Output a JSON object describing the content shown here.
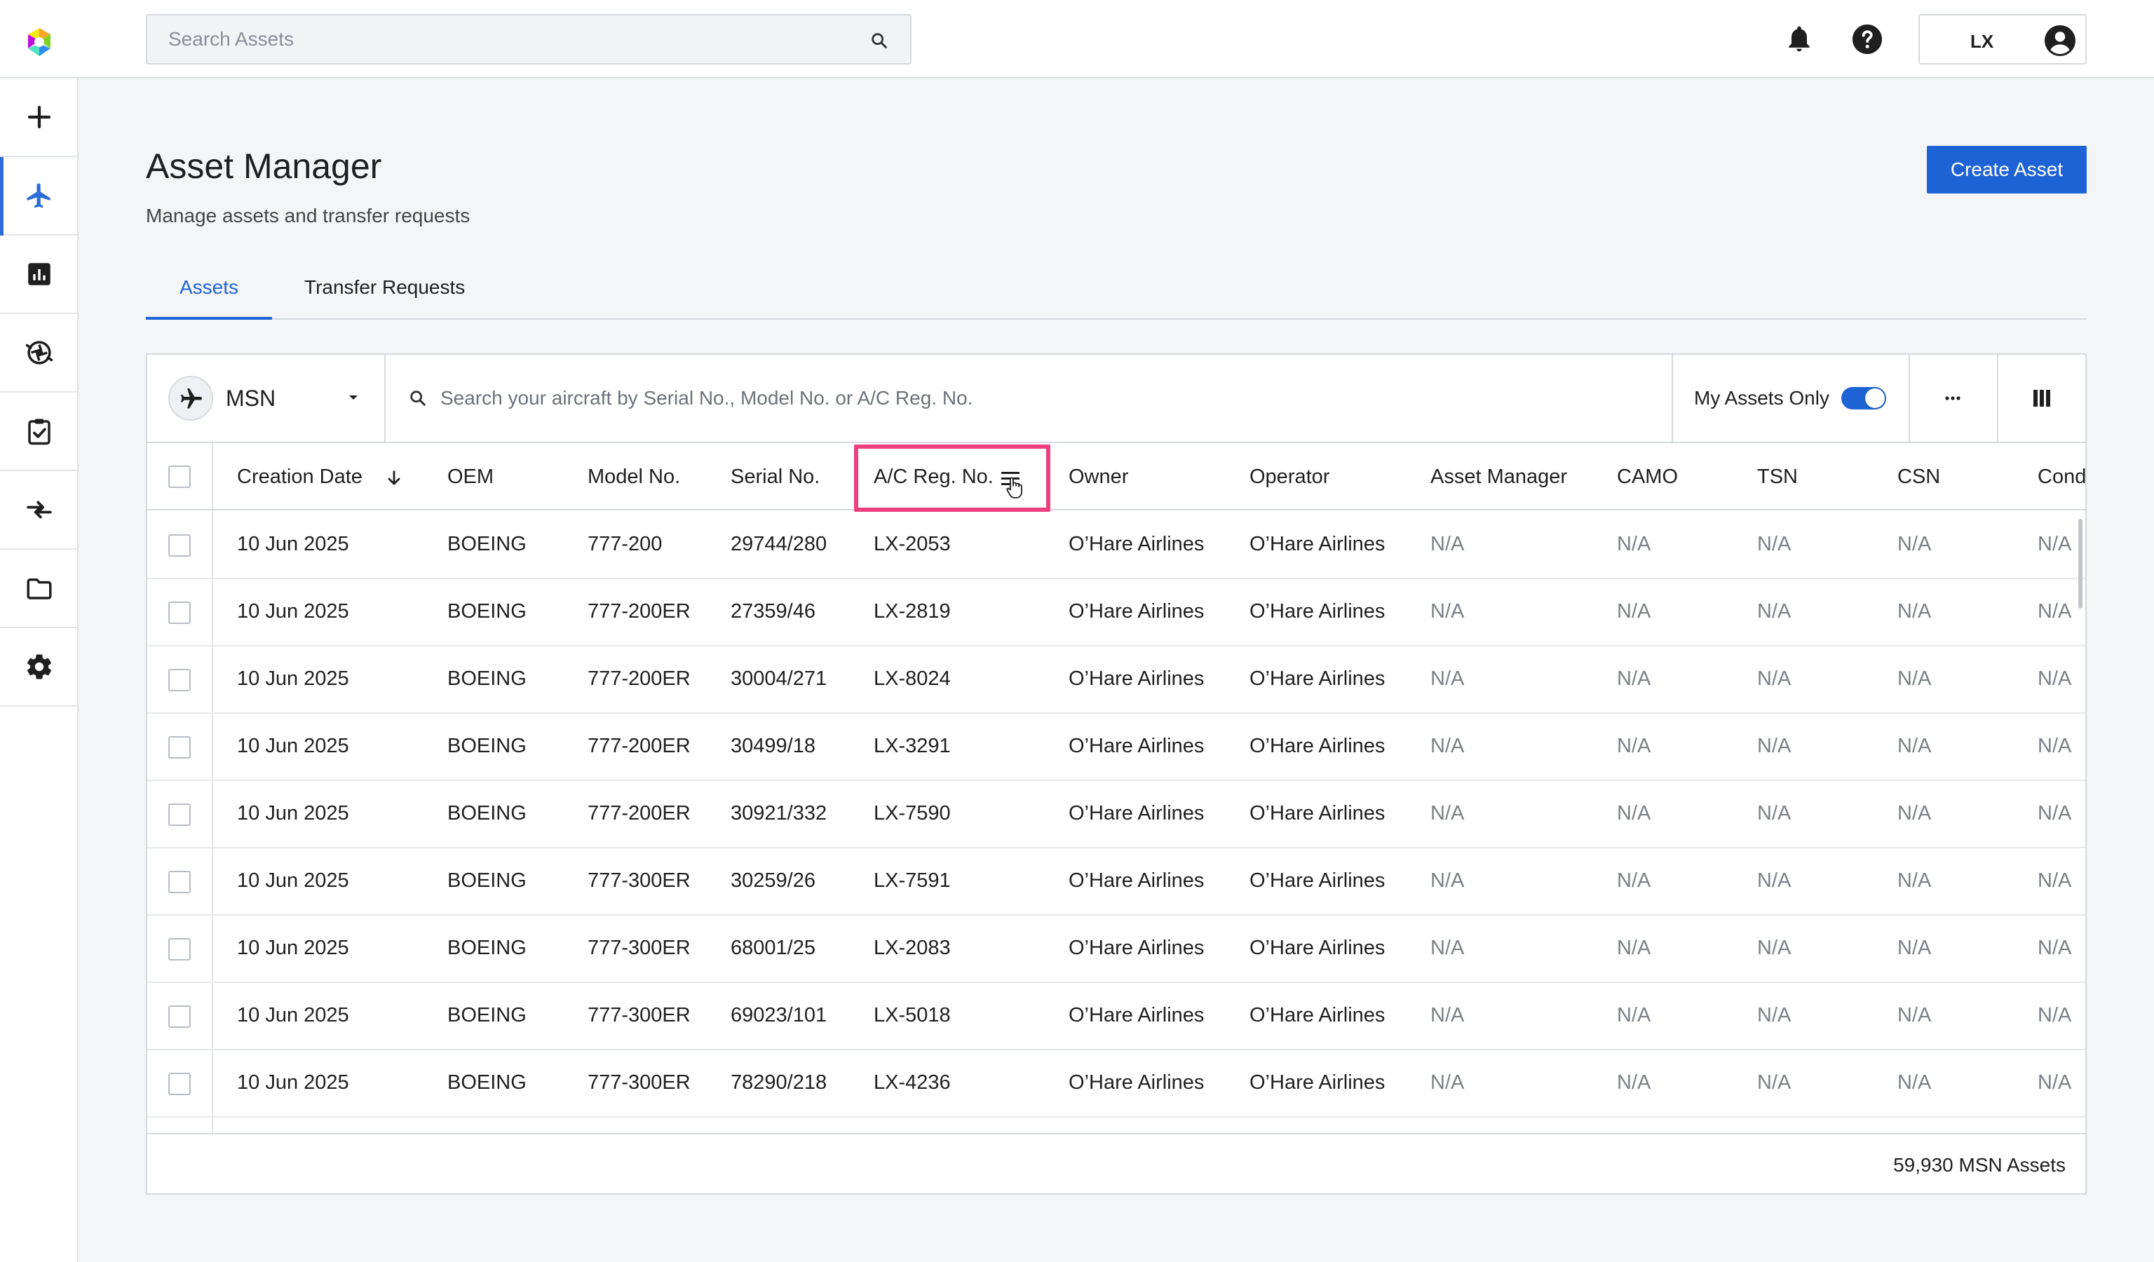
{
  "colors": {
    "accent": "#1e63d6",
    "highlight": "#ee3f7f",
    "toggle_on": "#1e63d6"
  },
  "header": {
    "search_placeholder": "Search Assets",
    "user_initials": "LX",
    "icons": [
      "app-logo-icon",
      "search-icon",
      "bell-icon",
      "help-icon",
      "account-icon"
    ]
  },
  "sidenav": {
    "items": [
      {
        "icon": "plus-icon",
        "active": false
      },
      {
        "icon": "airplane-icon",
        "active": true
      },
      {
        "icon": "chart-icon",
        "active": false
      },
      {
        "icon": "engine-icon",
        "active": false
      },
      {
        "icon": "clipboard-check-icon",
        "active": false
      },
      {
        "icon": "transfer-arrows-icon",
        "active": false
      },
      {
        "icon": "folder-icon",
        "active": false
      },
      {
        "icon": "gear-icon",
        "active": false
      }
    ]
  },
  "page": {
    "title": "Asset Manager",
    "subtitle": "Manage assets and transfer requests",
    "create_button": "Create Asset"
  },
  "tabs": [
    {
      "label": "Assets",
      "active": true
    },
    {
      "label": "Transfer Requests",
      "active": false
    }
  ],
  "toolbar": {
    "type_selected": "MSN",
    "search_placeholder": "Search your aircraft by Serial No., Model No. or A/C Reg. No.",
    "my_assets_label": "My Assets Only",
    "my_assets_on": true
  },
  "table": {
    "columns": [
      "Creation Date",
      "OEM",
      "Model No.",
      "Serial No.",
      "A/C Reg. No.",
      "Owner",
      "Operator",
      "Asset Manager",
      "CAMO",
      "TSN",
      "CSN",
      "Cond"
    ],
    "sorted_column": "Creation Date",
    "sort_direction": "descending",
    "rows": [
      [
        "10 Jun 2025",
        "BOEING",
        "777-200",
        "29744/280",
        "LX-2053",
        "O’Hare Airlines",
        "O’Hare Airlines",
        "N/A",
        "N/A",
        "N/A",
        "N/A",
        "N/A"
      ],
      [
        "10 Jun 2025",
        "BOEING",
        "777-200ER",
        "27359/46",
        "LX-2819",
        "O’Hare Airlines",
        "O’Hare Airlines",
        "N/A",
        "N/A",
        "N/A",
        "N/A",
        "N/A"
      ],
      [
        "10 Jun 2025",
        "BOEING",
        "777-200ER",
        "30004/271",
        "LX-8024",
        "O’Hare Airlines",
        "O’Hare Airlines",
        "N/A",
        "N/A",
        "N/A",
        "N/A",
        "N/A"
      ],
      [
        "10 Jun 2025",
        "BOEING",
        "777-200ER",
        "30499/18",
        "LX-3291",
        "O’Hare Airlines",
        "O’Hare Airlines",
        "N/A",
        "N/A",
        "N/A",
        "N/A",
        "N/A"
      ],
      [
        "10 Jun 2025",
        "BOEING",
        "777-200ER",
        "30921/332",
        "LX-7590",
        "O’Hare Airlines",
        "O’Hare Airlines",
        "N/A",
        "N/A",
        "N/A",
        "N/A",
        "N/A"
      ],
      [
        "10 Jun 2025",
        "BOEING",
        "777-300ER",
        "30259/26",
        "LX-7591",
        "O’Hare Airlines",
        "O’Hare Airlines",
        "N/A",
        "N/A",
        "N/A",
        "N/A",
        "N/A"
      ],
      [
        "10 Jun 2025",
        "BOEING",
        "777-300ER",
        "68001/25",
        "LX-2083",
        "O’Hare Airlines",
        "O’Hare Airlines",
        "N/A",
        "N/A",
        "N/A",
        "N/A",
        "N/A"
      ],
      [
        "10 Jun 2025",
        "BOEING",
        "777-300ER",
        "69023/101",
        "LX-5018",
        "O’Hare Airlines",
        "O’Hare Airlines",
        "N/A",
        "N/A",
        "N/A",
        "N/A",
        "N/A"
      ],
      [
        "10 Jun 2025",
        "BOEING",
        "777-300ER",
        "78290/218",
        "LX-4236",
        "O’Hare Airlines",
        "O’Hare Airlines",
        "N/A",
        "N/A",
        "N/A",
        "N/A",
        "N/A"
      ]
    ],
    "footer_count": "59,930 MSN Assets"
  }
}
